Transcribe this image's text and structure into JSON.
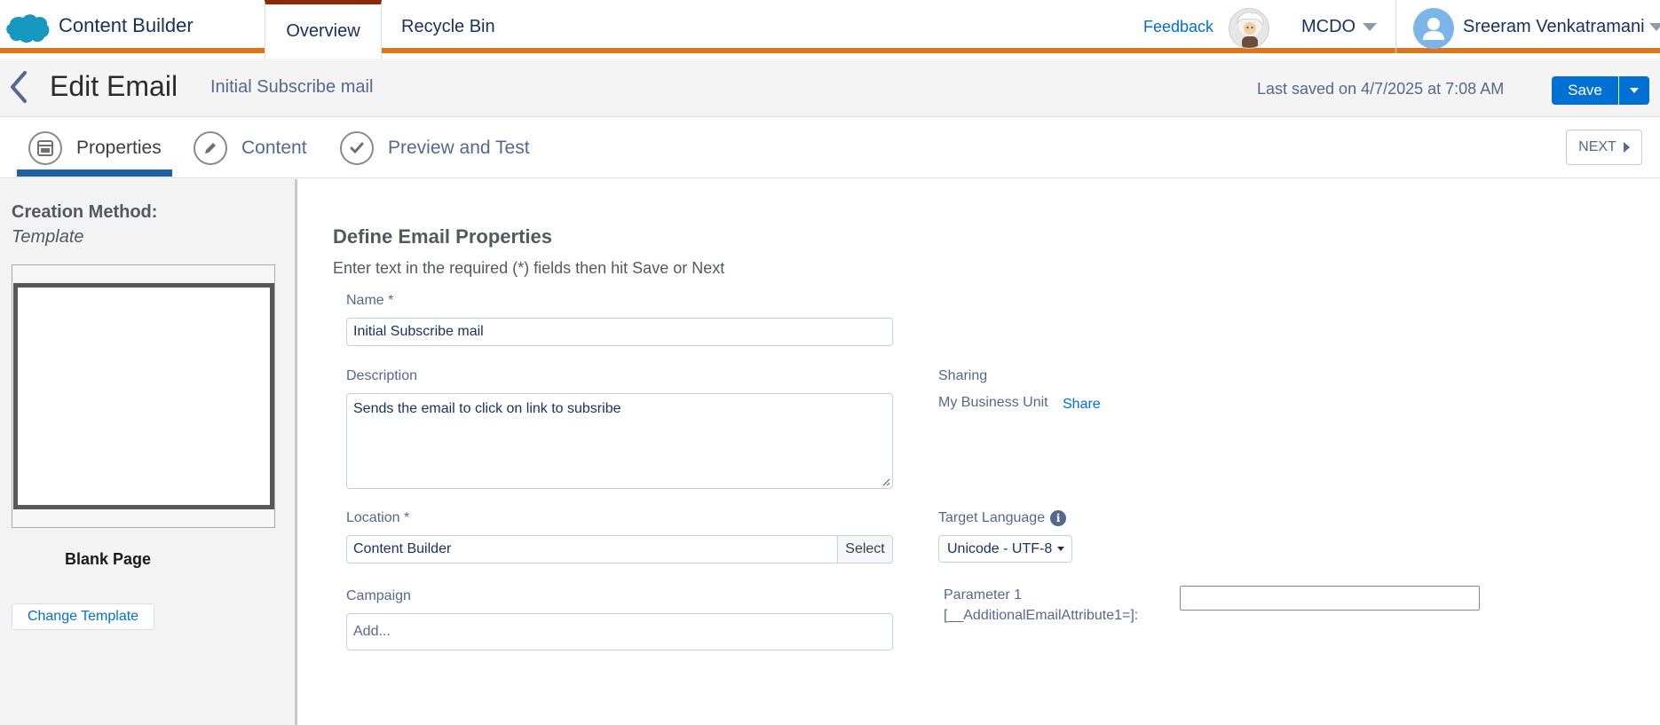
{
  "topbar": {
    "app_title": "Content Builder",
    "tabs": [
      {
        "label": "Overview",
        "active": true
      },
      {
        "label": "Recycle Bin",
        "active": false
      }
    ],
    "feedback": "Feedback",
    "business_unit": "MCDO",
    "user_name": "Sreeram Venkatramani",
    "accent_color": "#d8771d",
    "brand_color": "#1798c1"
  },
  "header": {
    "title": "Edit Email",
    "subtitle": "Initial Subscribe mail",
    "last_saved": "Last saved on 4/7/2025 at 7:08 AM",
    "save_label": "Save"
  },
  "steps": {
    "items": [
      {
        "label": "Properties",
        "icon": "template-icon",
        "active": true
      },
      {
        "label": "Content",
        "icon": "pencil-icon",
        "active": false
      },
      {
        "label": "Preview and Test",
        "icon": "check-icon",
        "active": false
      }
    ],
    "next_label": "NEXT"
  },
  "left_panel": {
    "creation_method_label": "Creation Method:",
    "creation_method_value": "Template",
    "template_name": "Blank Page",
    "change_template_label": "Change Template"
  },
  "form": {
    "title": "Define Email Properties",
    "subtitle": "Enter text in the required (*) fields then hit Save or Next",
    "name": {
      "label": "Name *",
      "value": "Initial Subscribe mail"
    },
    "description": {
      "label": "Description",
      "value": "Sends the email to click on link to subsribe"
    },
    "location": {
      "label": "Location *",
      "value": "Content Builder",
      "select_label": "Select"
    },
    "campaign": {
      "label": "Campaign",
      "placeholder": "Add..."
    },
    "sharing": {
      "label": "Sharing",
      "value": "My Business Unit",
      "share_label": "Share"
    },
    "target_language": {
      "label": "Target Language",
      "value": "Unicode - UTF-8"
    },
    "parameter": {
      "label_line1": "Parameter 1",
      "label_line2": "[__AdditionalEmailAttribute1=]:",
      "value": ""
    }
  }
}
